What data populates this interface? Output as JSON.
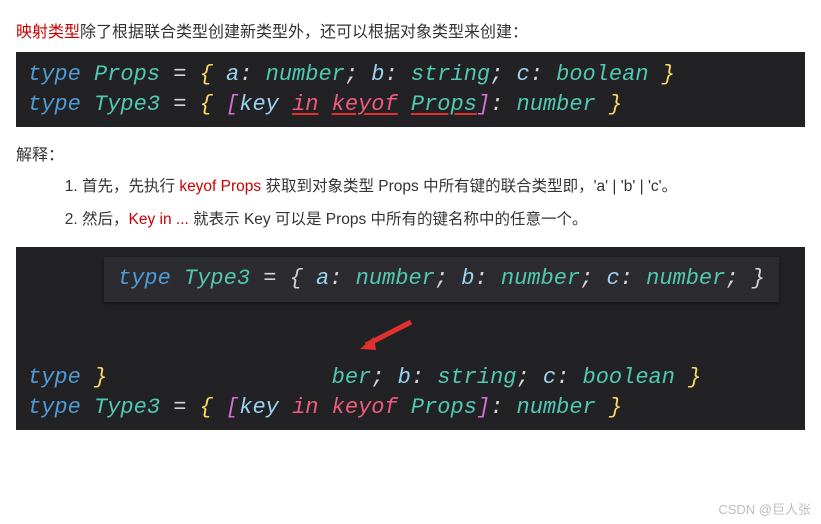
{
  "intro": {
    "highlight": "映射类型",
    "rest": "除了根据联合类型创建新类型外，还可以根据对象类型来创建：",
    "punct_space": ""
  },
  "code1": {
    "kw_type": "type",
    "props_name": "Props",
    "eq": "=",
    "lbrace": "{",
    "a": "a",
    "b": "b",
    "c": "c",
    "colon": ":",
    "t_number": "number",
    "t_string": "string",
    "t_boolean": "boolean",
    "semi": ";",
    "rbrace": "}",
    "type3_name": "Type3",
    "lbracket": "[",
    "rbracket": "]",
    "key": "key",
    "in": "in",
    "keyof": "keyof",
    "props_ref": "Props"
  },
  "explain": {
    "heading": "解释：",
    "item1_pre": "首先，先执行 ",
    "item1_red": "keyof Props",
    "item1_post": " 获取到对象类型 Props 中所有键的联合类型即，'a' | 'b' | 'c'。",
    "item2_pre": "然后，",
    "item2_red": "Key in ...",
    "item2_post": " 就表示 Key 可以是 Props 中所有的键名称中的任意一个。"
  },
  "tooltip": {
    "line1_kw": "type",
    "line1_name": "Type3",
    "line1_eq": "=",
    "line1_lbrace": "{",
    "a": "a",
    "b": "b",
    "c": "c",
    "colon": ":",
    "number": "number",
    "semi": ";",
    "rbrace": "}"
  },
  "code2_overlay": {
    "type_kw": "type",
    "type3": "Type3",
    "props": "Props",
    "rbrace": "}",
    "partial_ber": "ber",
    "semi": ";",
    "b": "b",
    "c": "c",
    "colon": ":",
    "string": "string",
    "boolean": "boolean",
    "eq": "=",
    "lbrace": "{",
    "lbracket": "[",
    "rbracket": "]",
    "key": "key",
    "in": "in",
    "keyof": "keyof",
    "number": "number"
  },
  "watermark": "CSDN @巨人张"
}
